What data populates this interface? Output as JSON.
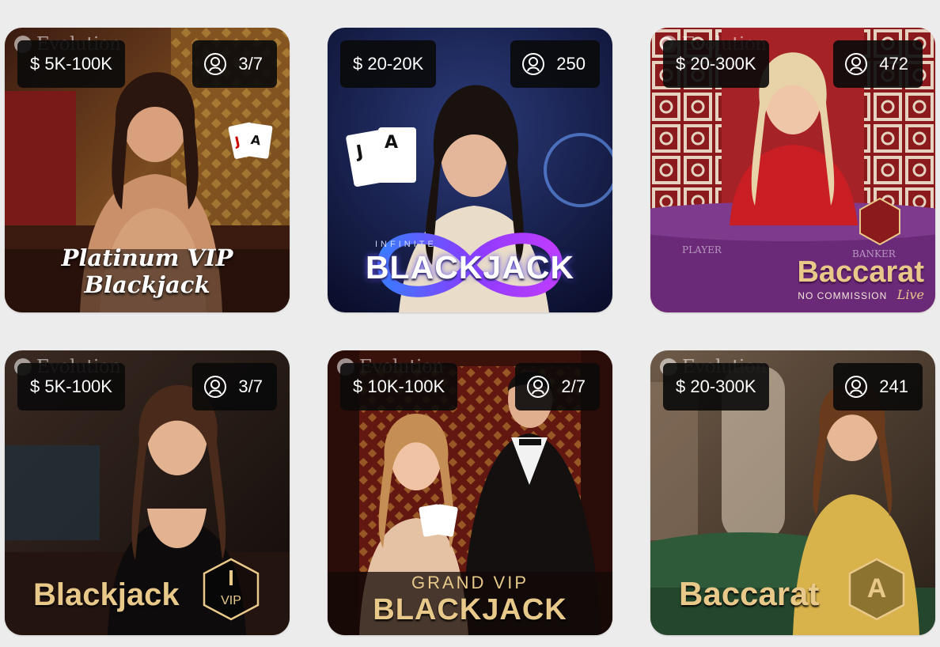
{
  "provider_label": "Evolution",
  "tiles": [
    {
      "limit": "$ 5K-100K",
      "seats": "3/7",
      "title": "Platinum VIP Blackjack"
    },
    {
      "limit": "$ 20-20K",
      "seats": "250",
      "title_small": "INFINITE",
      "title": "BLACKJACK"
    },
    {
      "limit": "$ 20-300K",
      "seats": "472",
      "title": "Baccarat",
      "subtitle": "NO COMMISSION",
      "subtitle2": "Live",
      "table_left": "PLAYER",
      "table_right": "BANKER"
    },
    {
      "limit": "$ 5K-100K",
      "seats": "3/7",
      "title": "Blackjack",
      "emblem_top": "I",
      "emblem_bottom": "VIP"
    },
    {
      "limit": "$ 10K-100K",
      "seats": "2/7",
      "title_small": "GRAND VIP",
      "title": "BLACKJACK"
    },
    {
      "limit": "$ 20-300K",
      "seats": "241",
      "title": "Baccarat",
      "emblem_top": "A"
    }
  ],
  "colors": {
    "page_background": "#ececec",
    "badge_background": "#0a0a0a",
    "gold_text": "#e9c98a",
    "table_purple": "#6b2a78",
    "table_green": "#2f5a3a"
  }
}
